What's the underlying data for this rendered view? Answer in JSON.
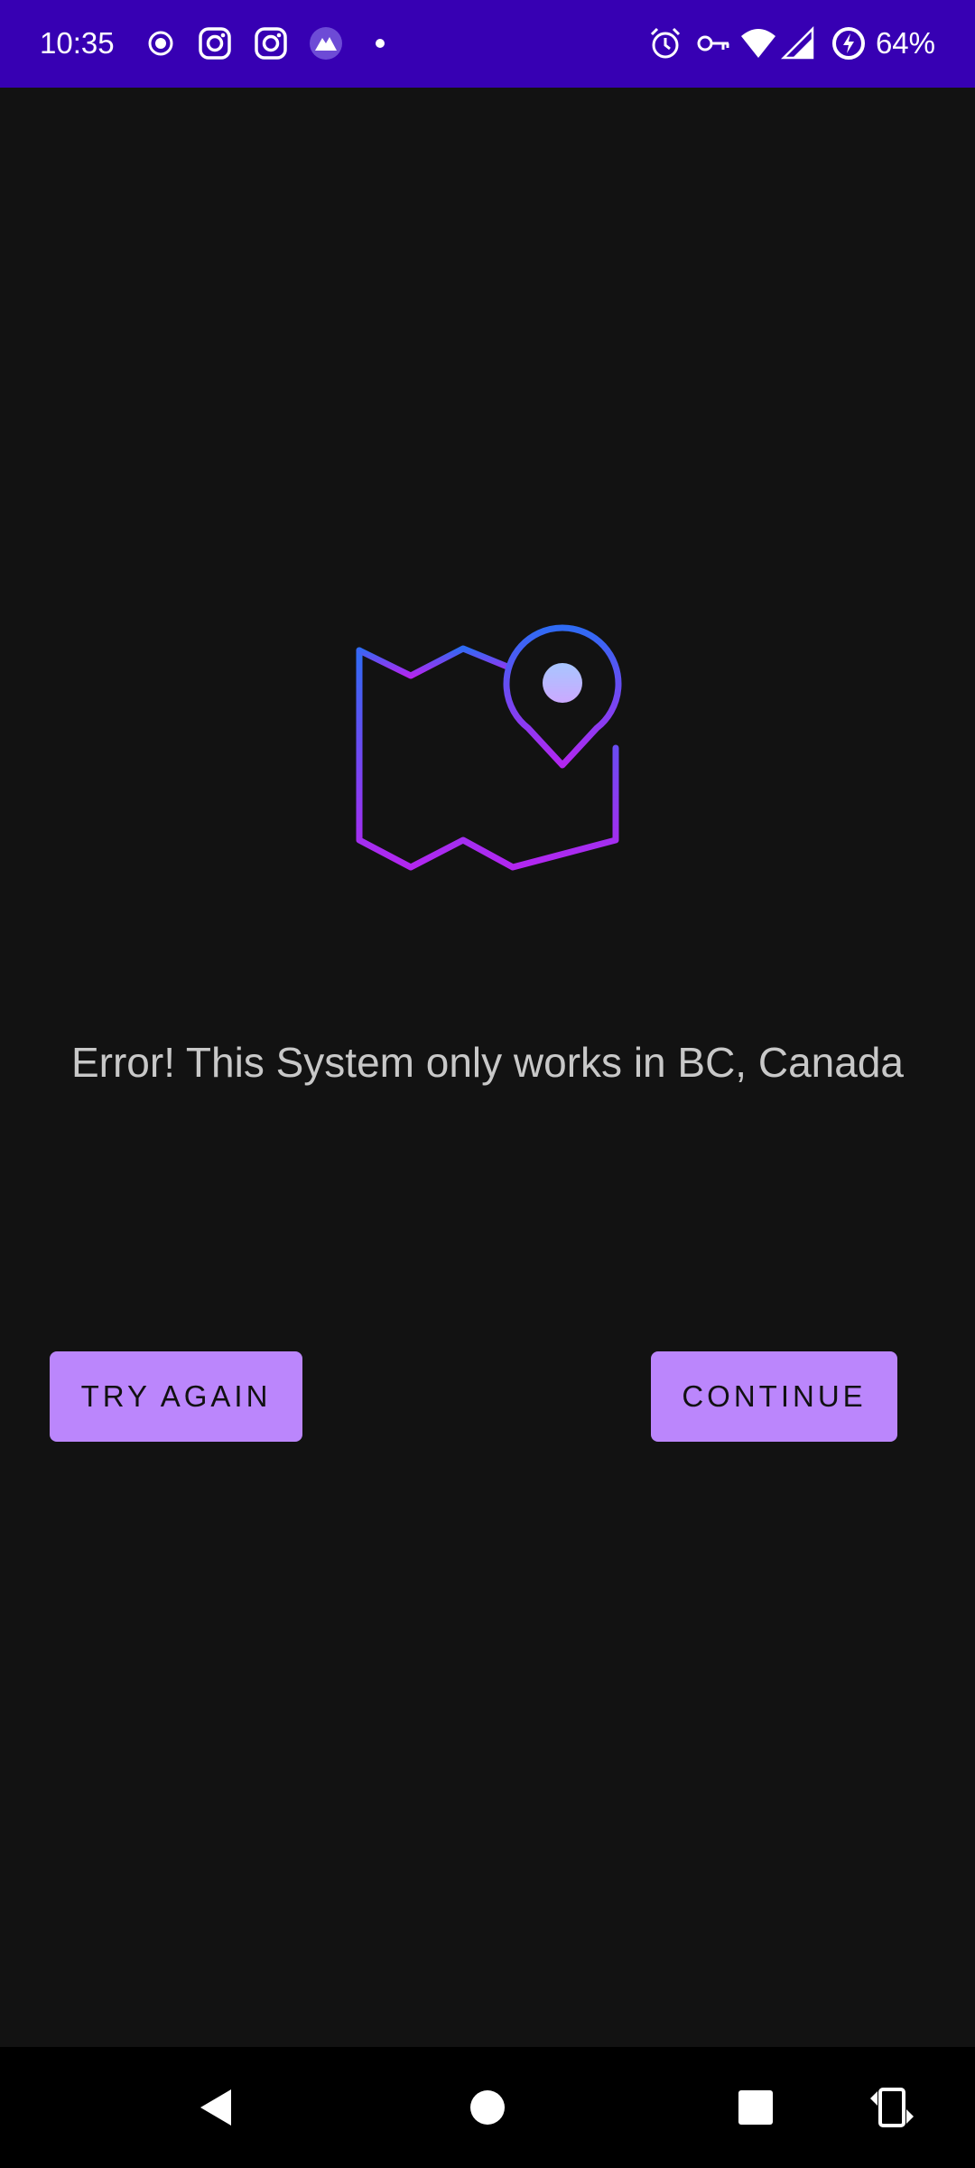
{
  "status_bar": {
    "time": "10:35",
    "battery": "64%",
    "background_color": "#3700b3",
    "left_icons": [
      "record-icon",
      "instagram-icon",
      "instagram-icon",
      "vpn-app-icon",
      "dot-icon"
    ],
    "right_icons": [
      "alarm-icon",
      "vpn-key-icon",
      "wifi-icon",
      "signal-icon",
      "battery-saver-icon"
    ]
  },
  "main": {
    "illustration": "map-location-icon",
    "error_message": "Error! This System only works in BC, Canada"
  },
  "buttons": {
    "try_again_label": "TRY AGAIN",
    "continue_label": "CONTINUE",
    "color": "#bb86fc"
  },
  "nav_bar": {
    "items": [
      "back-icon",
      "home-icon",
      "recents-icon",
      "rotate-icon"
    ]
  }
}
